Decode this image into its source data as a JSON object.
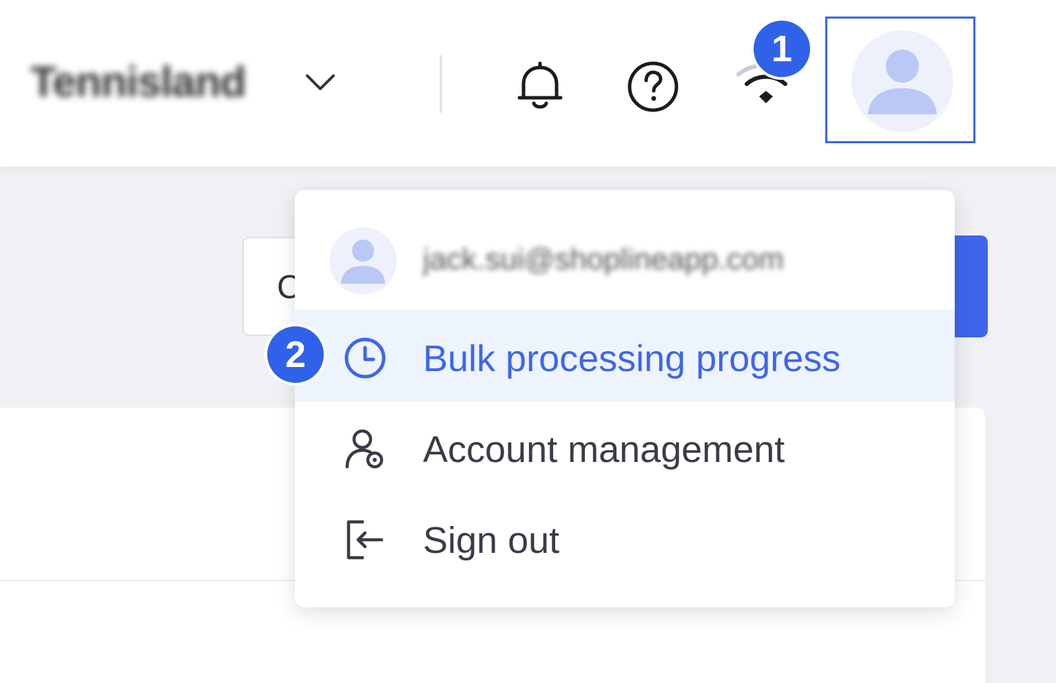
{
  "header": {
    "store_name": "Tennisland",
    "icons": [
      "chevron-down-icon",
      "bell-icon",
      "help-icon",
      "wifi-icon",
      "avatar-icon"
    ]
  },
  "steps": {
    "step1": "1",
    "step2": "2"
  },
  "background": {
    "input_partial_text": "C"
  },
  "dropdown": {
    "email": "jack.sui@shoplineapp.com",
    "items": [
      {
        "label": "Bulk processing progress",
        "icon": "clock-icon",
        "active": true
      },
      {
        "label": "Account management",
        "icon": "user-settings-icon",
        "active": false
      },
      {
        "label": "Sign out",
        "icon": "sign-out-icon",
        "active": false
      }
    ]
  },
  "colors": {
    "accent": "#3f66ea",
    "step_badge": "#2f62e8",
    "highlight_border": "#3a64f0",
    "active_row_bg": "#eef4fe"
  }
}
